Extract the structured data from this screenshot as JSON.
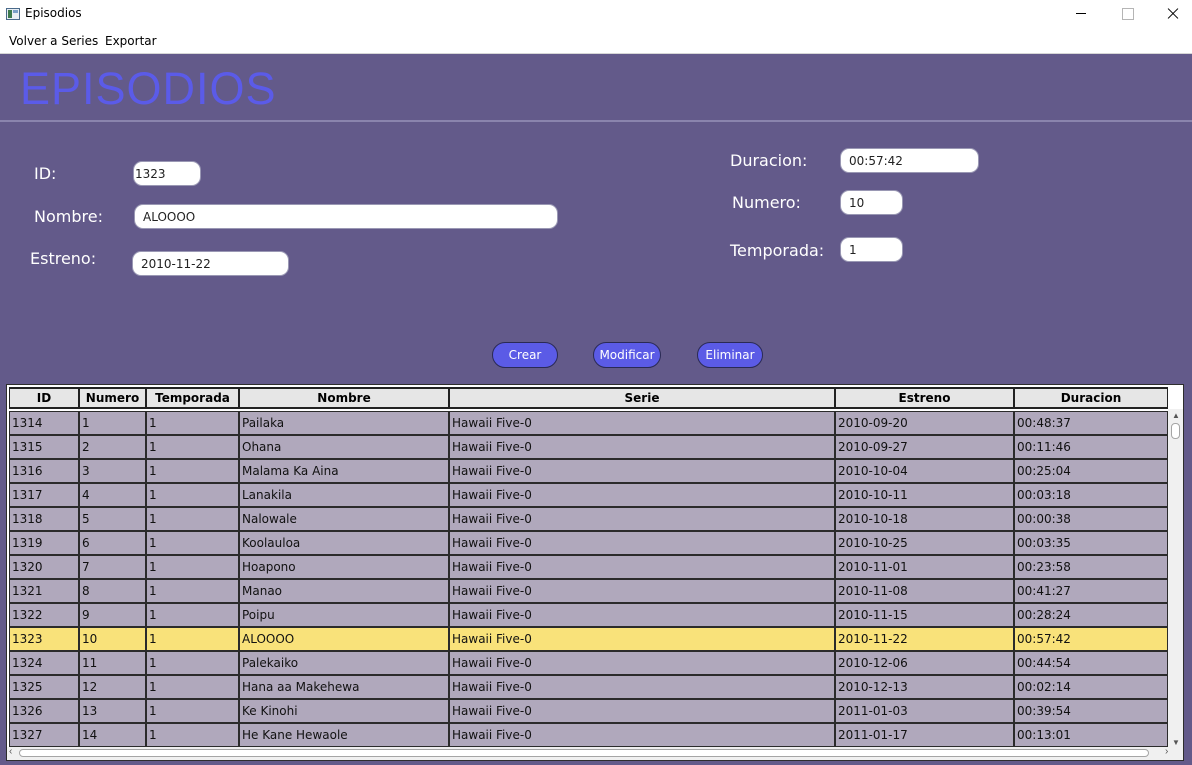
{
  "window": {
    "title": "Episodios"
  },
  "menu": {
    "items": [
      "Volver a Series",
      "Exportar"
    ]
  },
  "page": {
    "title": "EPISODIOS"
  },
  "form": {
    "id_label": "ID:",
    "id_value": "1323",
    "nombre_label": "Nombre:",
    "nombre_value": "ALOOOO",
    "estreno_label": "Estreno:",
    "estreno_value": "2010-11-22",
    "duracion_label": "Duracion:",
    "duracion_value": "00:57:42",
    "numero_label": "Numero:",
    "numero_value": "10",
    "temporada_label": "Temporada:",
    "temporada_value": "1"
  },
  "actions": {
    "crear": "Crear",
    "modificar": "Modificar",
    "eliminar": "Eliminar"
  },
  "table": {
    "columns": [
      "ID",
      "Numero",
      "Temporada",
      "Nombre",
      "Serie",
      "Estreno",
      "Duracion"
    ],
    "selected_id": "1323",
    "rows": [
      [
        "1314",
        "1",
        "1",
        "Pailaka",
        "Hawaii Five-0",
        "2010-09-20",
        "00:48:37"
      ],
      [
        "1315",
        "2",
        "1",
        "Ohana",
        "Hawaii Five-0",
        "2010-09-27",
        "00:11:46"
      ],
      [
        "1316",
        "3",
        "1",
        "Malama Ka Aina",
        "Hawaii Five-0",
        "2010-10-04",
        "00:25:04"
      ],
      [
        "1317",
        "4",
        "1",
        "Lanakila",
        "Hawaii Five-0",
        "2010-10-11",
        "00:03:18"
      ],
      [
        "1318",
        "5",
        "1",
        "Nalowale",
        "Hawaii Five-0",
        "2010-10-18",
        "00:00:38"
      ],
      [
        "1319",
        "6",
        "1",
        "Koolauloa",
        "Hawaii Five-0",
        "2010-10-25",
        "00:03:35"
      ],
      [
        "1320",
        "7",
        "1",
        "Hoapono",
        "Hawaii Five-0",
        "2010-11-01",
        "00:23:58"
      ],
      [
        "1321",
        "8",
        "1",
        "Manao",
        "Hawaii Five-0",
        "2010-11-08",
        "00:41:27"
      ],
      [
        "1322",
        "9",
        "1",
        "Poipu",
        "Hawaii Five-0",
        "2010-11-15",
        "00:28:24"
      ],
      [
        "1323",
        "10",
        "1",
        "ALOOOO",
        "Hawaii Five-0",
        "2010-11-22",
        "00:57:42"
      ],
      [
        "1324",
        "11",
        "1",
        "Palekaiko",
        "Hawaii Five-0",
        "2010-12-06",
        "00:44:54"
      ],
      [
        "1325",
        "12",
        "1",
        "Hana aa Makehewa",
        "Hawaii Five-0",
        "2010-12-13",
        "00:02:14"
      ],
      [
        "1326",
        "13",
        "1",
        "Ke Kinohi",
        "Hawaii Five-0",
        "2011-01-03",
        "00:39:54"
      ],
      [
        "1327",
        "14",
        "1",
        "He Kane Hewaole",
        "Hawaii Five-0",
        "2011-01-17",
        "00:13:01"
      ]
    ]
  },
  "colors": {
    "background": "#635a8a",
    "title": "#5b5be8",
    "button": "#5b5be6",
    "row": "#b0a8bc",
    "selected_row": "#f9e27a"
  }
}
